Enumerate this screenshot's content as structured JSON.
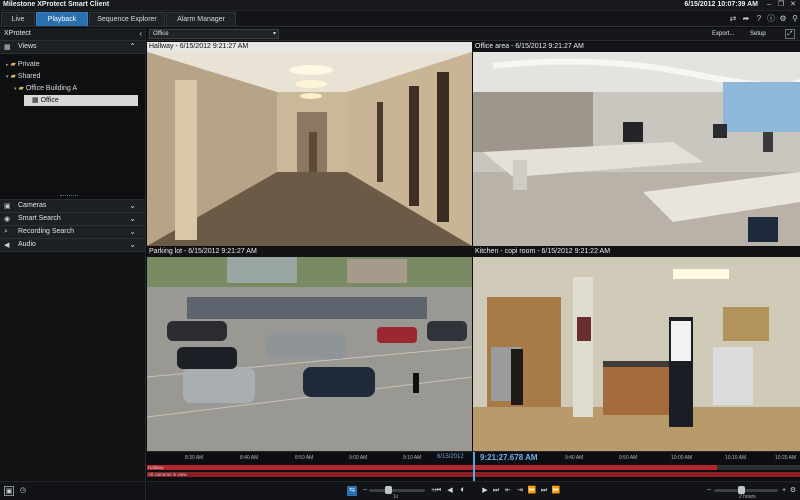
{
  "window": {
    "title": "Milestone XProtect Smart Client",
    "datetime": "6/15/2012 10:07:39 AM",
    "controls": [
      "–",
      "❐",
      "✕"
    ]
  },
  "tabs": [
    {
      "label": "Live",
      "active": false
    },
    {
      "label": "Playback",
      "active": true
    },
    {
      "label": "Sequence Explorer",
      "active": false
    },
    {
      "label": "Alarm Manager",
      "active": false
    }
  ],
  "toolbar_icons": [
    "switch-icon",
    "share-icon",
    "help-icon",
    "info-icon",
    "settings-icon",
    "gear-icon",
    "pin-icon"
  ],
  "left_panel": {
    "title": "XProtect",
    "views_label": "Views",
    "tree": [
      {
        "label": "Private",
        "level": 1,
        "icon": "▸"
      },
      {
        "label": "Shared",
        "level": 1,
        "icon": "▾"
      },
      {
        "label": "Office Building A",
        "level": 2,
        "icon": "▾"
      },
      {
        "label": "Office",
        "level": 3,
        "icon": "▦",
        "selected": true
      }
    ],
    "sections": [
      {
        "label": "Cameras",
        "icon": "▣"
      },
      {
        "label": "Smart Search",
        "icon": "◉"
      },
      {
        "label": "Recording Search",
        "icon": "⌕"
      },
      {
        "label": "Audio",
        "icon": "◀"
      }
    ]
  },
  "viewbar": {
    "selected_view": "Office",
    "export_label": "Export...",
    "setup_label": "Setup"
  },
  "tiles": [
    {
      "title": "Hallway - 6/15/2012 9:21:27 AM",
      "dark": false
    },
    {
      "title": "Office area - 6/15/2012 9:21:27 AM",
      "dark": true
    },
    {
      "title": "Parking lot - 6/15/2012 9:21:27 AM",
      "dark": true
    },
    {
      "title": "Kitchen - copi room - 6/15/2012 9:21:22 AM",
      "dark": true
    }
  ],
  "timeline": {
    "ticks_left": [
      "8:30 AM",
      "8:40 AM",
      "8:50 AM",
      "9:00 AM",
      "9:10 AM"
    ],
    "date": "6/15/2012",
    "current_time": "9:21:27.678 AM",
    "ticks_right": [
      "9:40 AM",
      "9:50 AM",
      "10:00 AM",
      "10:10 AM",
      "10:20 AM"
    ],
    "track1_label": "Hallway",
    "track2_label": "All cameras in view"
  },
  "controls": {
    "speed_label": "1x",
    "span_label": "2 hours"
  },
  "colors": {
    "accent": "#2b6fae",
    "recording": "#b3262c",
    "playhead": "#5aa2e0"
  }
}
